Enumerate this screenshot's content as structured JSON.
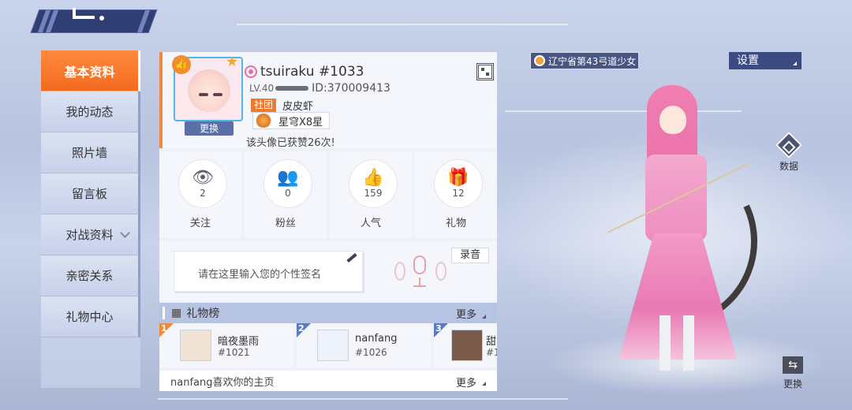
{
  "sidebar": {
    "items": [
      {
        "label": "基本资料",
        "active": true
      },
      {
        "label": "我的动态"
      },
      {
        "label": "照片墙"
      },
      {
        "label": "留言板"
      },
      {
        "label": "对战资料",
        "has_chevron": true
      },
      {
        "label": "亲密关系"
      },
      {
        "label": "礼物中心"
      }
    ]
  },
  "profile": {
    "name": "tsuiraku",
    "tag": "#1033",
    "level": "LV.40",
    "id_text": "ID:370009413",
    "club_tag": "社团",
    "club_name": "皮皮虾",
    "rank": "星穹X8星",
    "avatar_likes": "该头像已获赞26次!",
    "change_label": "更换"
  },
  "stats": [
    {
      "label": "关注",
      "value": "2",
      "icon": "eye-icon",
      "glyph": "👁"
    },
    {
      "label": "粉丝",
      "value": "0",
      "icon": "fans-icon",
      "glyph": "👥"
    },
    {
      "label": "人气",
      "value": "159",
      "icon": "thumbs-up-icon",
      "glyph": "👍"
    },
    {
      "label": "礼物",
      "value": "12",
      "icon": "gift-icon",
      "glyph": "🎁"
    }
  ],
  "signature": {
    "placeholder": "请在这里输入您的个性签名",
    "record_label": "录音"
  },
  "gifts": {
    "title": "礼物榜",
    "more_label": "更多",
    "items": [
      {
        "rank": "1",
        "name": "暗夜墨雨",
        "id": "#1021"
      },
      {
        "rank": "2",
        "name": "nanfang",
        "id": "#1026"
      },
      {
        "rank": "3",
        "name": "甜",
        "id": "#1"
      }
    ]
  },
  "footer": {
    "text": "nanfang喜欢你的主页",
    "more_label": "更多"
  },
  "right": {
    "location": "辽宁省第43弓道少女",
    "settings_label": "设置",
    "data_label": "数据",
    "swap_label": "更换"
  },
  "colors": {
    "accent_orange": "#f26a1f",
    "nav_blue": "#3b4a82",
    "panel_bg": "#eef1f8"
  }
}
